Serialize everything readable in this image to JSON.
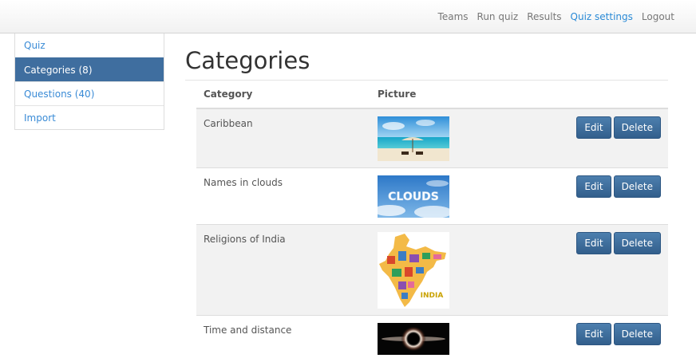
{
  "topnav": {
    "items": [
      {
        "label": "Teams",
        "active": false
      },
      {
        "label": "Run quiz",
        "active": false
      },
      {
        "label": "Results",
        "active": false
      },
      {
        "label": "Quiz settings",
        "active": true
      },
      {
        "label": "Logout",
        "active": false
      }
    ]
  },
  "sidebar": {
    "items": [
      {
        "label": "Quiz",
        "active": false
      },
      {
        "label": "Categories (8)",
        "active": true
      },
      {
        "label": "Questions (40)",
        "active": false
      },
      {
        "label": "Import",
        "active": false
      }
    ]
  },
  "page": {
    "title": "Categories"
  },
  "table": {
    "headers": {
      "category": "Category",
      "picture": "Picture"
    },
    "edit_label": "Edit",
    "delete_label": "Delete",
    "rows": [
      {
        "name": "Caribbean",
        "picture": "beach-picture"
      },
      {
        "name": "Names in clouds",
        "picture": "clouds-picture",
        "picture_text": "CLOUDS"
      },
      {
        "name": "Religions of India",
        "picture": "india-map-picture",
        "picture_text": "INDIA"
      },
      {
        "name": "Time and distance",
        "picture": "black-hole-picture"
      }
    ]
  },
  "colors": {
    "accent": "#3a8bd6",
    "active_bg": "#3f6e9f",
    "button": "#3f6e9f"
  }
}
